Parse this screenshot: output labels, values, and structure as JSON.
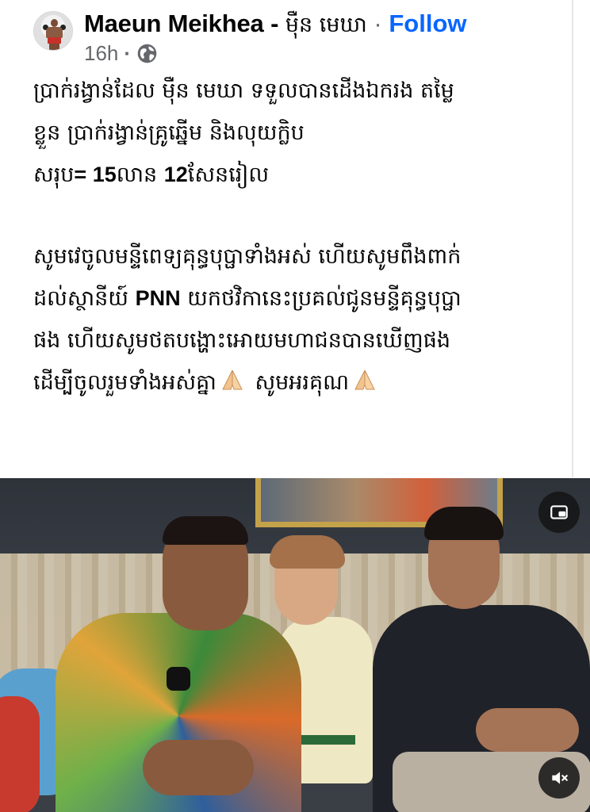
{
  "post": {
    "page_name": "Maeun Meikhea",
    "name_separator": "-",
    "khmer_name": "ម៉ឺន មេឃា",
    "dot_separator": "·",
    "follow_label": "Follow",
    "timestamp": "16h",
    "meta_dot": "·",
    "privacy_icon": "globe-icon",
    "text": {
      "line1": "ប្រាក់រង្វាន់ដែល ម៉ឺន មេឃា ទទួលបានដើងឯករង តម្លៃ",
      "line2": "ខ្លួន ប្រាក់រង្វាន់គ្រូឆ្នើម និងលុយក្លិប",
      "total_prefix": "សរុប",
      "total_eq": "= 15",
      "total_mid": "លាន ",
      "total_num2": "12",
      "total_suffix": "សែនរៀល",
      "p2_line1": "សូមវេចូលមន្ទីពេទ្យគុន្ធបុប្ផាទាំងអស់ ហើយសូមពឹងពាក់",
      "p2_line2_a": "ដល់ស្ថានីយ៍ ",
      "p2_line2_brand": "PNN",
      "p2_line2_b": " យកថវិកានេះប្រគល់ជូនមន្ទីគុន្ធបុប្ផា",
      "p2_line3": "ផង ហើយសូមថតបង្ហោះអោយមហាជនបានឃើញផង",
      "p2_line4_a": "ដើម្បីចូលរួមទាំងអស់គ្នា",
      "p2_line4_b": " សូមអរគុណ",
      "emoji": "folded-hands-emoji"
    }
  },
  "video": {
    "pip_icon": "picture-in-picture-icon",
    "mute_icon": "muted-speaker-icon"
  },
  "colors": {
    "follow": "#0866ff",
    "meta": "#65676b",
    "text": "#050505"
  }
}
